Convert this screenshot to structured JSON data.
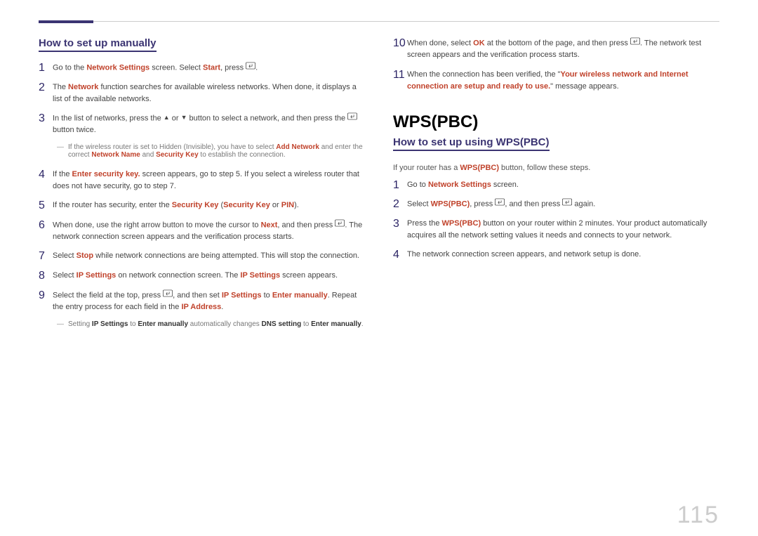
{
  "left": {
    "subhead": "How to set up manually",
    "steps": [
      {
        "n": "1",
        "parts": [
          {
            "t": "Go to the "
          },
          {
            "t": "Network Settings",
            "cls": "r"
          },
          {
            "t": " screen. Select "
          },
          {
            "t": "Start",
            "cls": "r"
          },
          {
            "t": ", press "
          },
          {
            "icon": "enter"
          },
          {
            "t": "."
          }
        ]
      },
      {
        "n": "2",
        "parts": [
          {
            "t": "The "
          },
          {
            "t": "Network",
            "cls": "r"
          },
          {
            "t": " function searches for available wireless networks. When done, it displays a list of the available networks."
          }
        ]
      },
      {
        "n": "3",
        "parts": [
          {
            "t": "In the list of networks, press the "
          },
          {
            "t": "▲",
            "cls": "tri"
          },
          {
            "t": " or "
          },
          {
            "t": "▼",
            "cls": "tri"
          },
          {
            "t": " button to select a network, and then press the "
          },
          {
            "icon": "enter"
          },
          {
            "t": " button twice."
          }
        ],
        "sub": [
          {
            "t": "If the wireless router is set to Hidden (Invisible), you have to select "
          },
          {
            "t": "Add Network",
            "cls": "r"
          },
          {
            "t": " and enter the correct "
          },
          {
            "t": "Network Name",
            "cls": "r"
          },
          {
            "t": " and "
          },
          {
            "t": "Security Key",
            "cls": "r"
          },
          {
            "t": " to establish the connection."
          }
        ]
      },
      {
        "n": "4",
        "parts": [
          {
            "t": "If the "
          },
          {
            "t": "Enter security key.",
            "cls": "r"
          },
          {
            "t": " screen appears, go to step 5. If you select a wireless router that does not have security, go to step 7."
          }
        ]
      },
      {
        "n": "5",
        "parts": [
          {
            "t": "If the router has security, enter the "
          },
          {
            "t": "Security Key",
            "cls": "r"
          },
          {
            "t": " ("
          },
          {
            "t": "Security Key",
            "cls": "r"
          },
          {
            "t": " or "
          },
          {
            "t": "PIN",
            "cls": "r"
          },
          {
            "t": ")."
          }
        ]
      },
      {
        "n": "6",
        "parts": [
          {
            "t": "When done, use the right arrow button to move the cursor to "
          },
          {
            "t": "Next",
            "cls": "r"
          },
          {
            "t": ", and then press "
          },
          {
            "icon": "enter"
          },
          {
            "t": ". The network connection screen appears and the verification process starts."
          }
        ]
      },
      {
        "n": "7",
        "parts": [
          {
            "t": "Select "
          },
          {
            "t": "Stop",
            "cls": "r"
          },
          {
            "t": " while network connections are being attempted. This will stop the connection."
          }
        ]
      },
      {
        "n": "8",
        "parts": [
          {
            "t": "Select "
          },
          {
            "t": "IP Settings",
            "cls": "r"
          },
          {
            "t": " on network connection screen. The "
          },
          {
            "t": "IP Settings",
            "cls": "r"
          },
          {
            "t": " screen appears."
          }
        ]
      },
      {
        "n": "9",
        "parts": [
          {
            "t": "Select the field at the top, press "
          },
          {
            "icon": "enter"
          },
          {
            "t": ", and then set "
          },
          {
            "t": "IP Settings",
            "cls": "r"
          },
          {
            "t": " to "
          },
          {
            "t": "Enter manually",
            "cls": "r"
          },
          {
            "t": ". Repeat the entry process for each field in the "
          },
          {
            "t": "IP Address",
            "cls": "r"
          },
          {
            "t": "."
          }
        ],
        "sub": [
          {
            "t": "Setting "
          },
          {
            "t": "IP Settings",
            "cls": "b"
          },
          {
            "t": " to "
          },
          {
            "t": "Enter manually",
            "cls": "b"
          },
          {
            "t": " automatically changes "
          },
          {
            "t": "DNS setting",
            "cls": "b"
          },
          {
            "t": " to "
          },
          {
            "t": "Enter manually",
            "cls": "b"
          },
          {
            "t": "."
          }
        ]
      }
    ]
  },
  "right": {
    "cont": [
      {
        "n": "10",
        "parts": [
          {
            "t": "When done, select "
          },
          {
            "t": "OK",
            "cls": "r"
          },
          {
            "t": " at the bottom of the page, and then press "
          },
          {
            "icon": "enter"
          },
          {
            "t": ". The network test screen appears and the verification process starts."
          }
        ]
      },
      {
        "n": "11",
        "parts": [
          {
            "t": "When the connection has been verified, the \""
          },
          {
            "t": "Your wireless network and Internet connection are setup and ready to use.",
            "cls": "r"
          },
          {
            "t": "\" message appears."
          }
        ]
      }
    ],
    "section": "WPS(PBC)",
    "subhead": "How to set up using WPS(PBC)",
    "intro_parts": [
      {
        "t": "If your router has a "
      },
      {
        "t": "WPS(PBC)",
        "cls": "r"
      },
      {
        "t": " button, follow these steps."
      }
    ],
    "steps": [
      {
        "n": "1",
        "parts": [
          {
            "t": "Go to "
          },
          {
            "t": "Network Settings",
            "cls": "r"
          },
          {
            "t": " screen."
          }
        ]
      },
      {
        "n": "2",
        "parts": [
          {
            "t": "Select "
          },
          {
            "t": "WPS(PBC)",
            "cls": "r"
          },
          {
            "t": ", press "
          },
          {
            "icon": "enter"
          },
          {
            "t": ", and then press "
          },
          {
            "icon": "enter"
          },
          {
            "t": " again."
          }
        ]
      },
      {
        "n": "3",
        "parts": [
          {
            "t": "Press the "
          },
          {
            "t": "WPS(PBC)",
            "cls": "r"
          },
          {
            "t": " button on your router within 2 minutes. Your product automatically acquires all the network setting values it needs and connects to your network."
          }
        ]
      },
      {
        "n": "4",
        "parts": [
          {
            "t": "The network connection screen appears, and network setup is done."
          }
        ]
      }
    ]
  },
  "pagenum": "115"
}
